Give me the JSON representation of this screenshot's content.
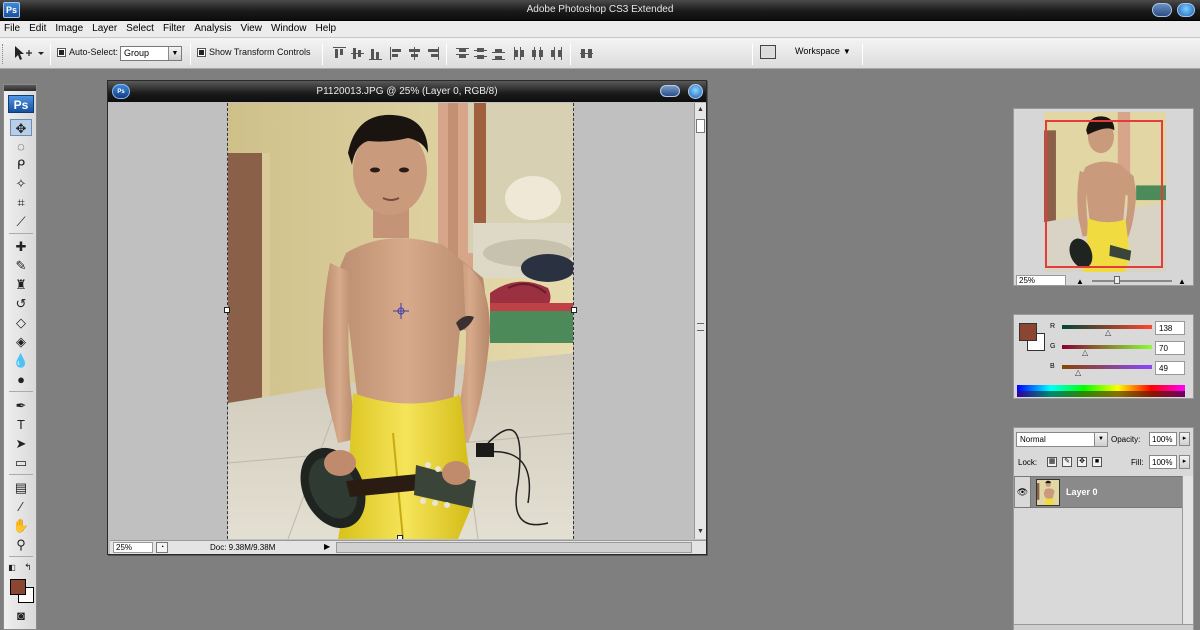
{
  "app": {
    "title": "Adobe Photoshop CS3 Extended",
    "logo": "Ps"
  },
  "menu": [
    "File",
    "Edit",
    "Image",
    "Layer",
    "Select",
    "Filter",
    "Analysis",
    "View",
    "Window",
    "Help"
  ],
  "options": {
    "auto_select_label": "Auto-Select:",
    "auto_select_value": "Group",
    "show_transform_label": "Show Transform Controls",
    "workspace_label": "Workspace"
  },
  "toolbox": {
    "logo": "Ps"
  },
  "document": {
    "title": "P1120013.JPG @ 25% (Layer 0, RGB/8)",
    "zoom": "25%",
    "doc_info": "Doc: 9.38M/9.38M"
  },
  "navigator": {
    "zoom": "25%"
  },
  "color": {
    "r_label": "R",
    "g_label": "G",
    "b_label": "B",
    "r_value": "138",
    "g_value": "70",
    "b_value": "49",
    "foreground": "#8a4630",
    "background": "#ffffff"
  },
  "layers": {
    "blend_mode": "Normal",
    "opacity_label": "Opacity:",
    "opacity_value": "100%",
    "lock_label": "Lock:",
    "fill_label": "Fill:",
    "fill_value": "100%",
    "items": [
      {
        "name": "Layer 0"
      }
    ]
  }
}
